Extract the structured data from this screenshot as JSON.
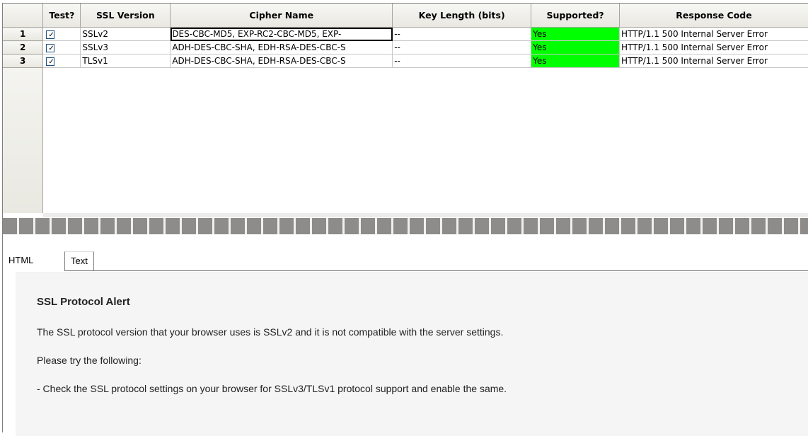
{
  "table": {
    "columns": [
      "",
      "Test?",
      "SSL Version",
      "Cipher Name",
      "Key Length (bits)",
      "Supported?",
      "Response Code"
    ],
    "rows": [
      {
        "num": "1",
        "checked": "✓",
        "ssl_version": "SSLv2",
        "cipher": "DES-CBC-MD5, EXP-RC2-CBC-MD5, EXP-",
        "key_length": "--",
        "supported": "Yes",
        "response": "HTTP/1.1 500 Internal Server Error"
      },
      {
        "num": "2",
        "checked": "✓",
        "ssl_version": "SSLv3",
        "cipher": "ADH-DES-CBC-SHA, EDH-RSA-DES-CBC-S",
        "key_length": "--",
        "supported": "Yes",
        "response": "HTTP/1.1 500 Internal Server Error"
      },
      {
        "num": "3",
        "checked": "✓",
        "ssl_version": "TLSv1",
        "cipher": "ADH-DES-CBC-SHA, EDH-RSA-DES-CBC-S",
        "key_length": "--",
        "supported": "Yes",
        "response": "HTTP/1.1 500 Internal Server Error"
      }
    ],
    "supported_color": "#00ff00"
  },
  "tabs": [
    {
      "label": "HTML",
      "active": true
    },
    {
      "label": "Text",
      "active": false
    }
  ],
  "content": {
    "title": "SSL Protocol Alert",
    "paragraph1": "The SSL protocol version that your browser uses is SSLv2 and it is not compatible with the server settings.",
    "paragraph2": "Please try the following:",
    "paragraph3": "- Check the SSL protocol settings on your browser for SSLv3/TLSv1 protocol support and enable the same."
  }
}
